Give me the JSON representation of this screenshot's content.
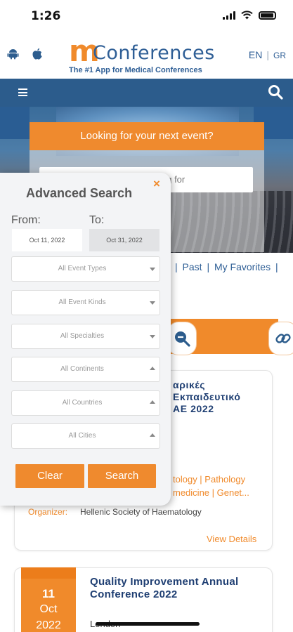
{
  "status_bar": {
    "time": "1:26"
  },
  "header": {
    "logo_m": "m",
    "logo_word": "Conferences",
    "tagline": "The #1 App for Medical Conferences",
    "lang_en": "EN",
    "lang_sep": "|",
    "lang_gr": "GR",
    "platform_icons": [
      "android-icon",
      "apple-icon"
    ]
  },
  "navbar": {
    "menu_icon": "hamburger-icon",
    "search_icon": "search-icon"
  },
  "hero": {
    "panel_title": "Looking for your next event?",
    "search_placeholder_visible": "ng for"
  },
  "filters": {
    "partial": "|",
    "past": "Past",
    "sep": "|",
    "favorites": "My Favorites",
    "trail": "|"
  },
  "advanced_search": {
    "title": "Advanced Search",
    "close": "×",
    "from_label": "From:",
    "to_label": "To:",
    "from_date": "Oct 11, 2022",
    "to_date": "Oct 31, 2022",
    "selects": [
      {
        "value": "All Event Types",
        "arrow": "down"
      },
      {
        "value": "All Event Kinds",
        "arrow": "down"
      },
      {
        "value": "All Specialties",
        "arrow": "down"
      },
      {
        "value": "All Continents",
        "arrow": "up"
      },
      {
        "value": "All Countries",
        "arrow": "up"
      },
      {
        "value": "All Cities",
        "arrow": "up"
      }
    ],
    "clear_label": "Clear",
    "search_label": "Search"
  },
  "card1": {
    "title_line1": "αρικές",
    "title_line2": "Εκπαιδευτικό",
    "title_line3": "ΑΕ 2022",
    "spec_line1": "tology | Pathology",
    "spec_line2": "medicine | Genet...",
    "organizer_label": "Organizer:",
    "organizer_value": "Hellenic Society of Haematology",
    "view_details": "View Details"
  },
  "card2": {
    "day": "11",
    "month": "Oct",
    "year": "2022",
    "title": "Quality Improvement Annual Conference 2022",
    "location": "London"
  },
  "colors": {
    "brand_orange": "#f08a2b",
    "brand_blue": "#2c5c8c",
    "title_navy": "#1e3e72"
  }
}
